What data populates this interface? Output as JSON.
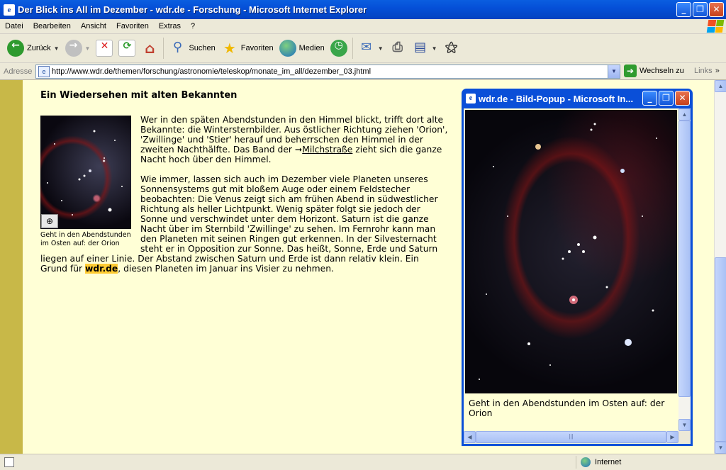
{
  "window": {
    "title": "Der Blick ins All im Dezember - wdr.de - Forschung - Microsoft Internet Explorer",
    "minimize": "_",
    "maximize": "❐",
    "close": "✕"
  },
  "menu": [
    "Datei",
    "Bearbeiten",
    "Ansicht",
    "Favoriten",
    "Extras",
    "?"
  ],
  "toolbar": {
    "back_label": "Zurück",
    "search_label": "Suchen",
    "favorites_label": "Favoriten",
    "media_label": "Medien"
  },
  "address": {
    "label": "Adresse",
    "url": "http://www.wdr.de/themen/forschung/astronomie/teleskop/monate_im_all/dezember_03.jhtml",
    "go_label": "Wechseln zu",
    "links_label": "Links"
  },
  "article": {
    "heading": "Ein Wiedersehen mit alten Bekannten",
    "thumb_caption": "Geht in den Abendstunden im Osten auf: der Orion",
    "p1_before": "Wer in den späten Abendstunden in den Himmel blickt, trifft dort alte Bekannte: die Wintersternbilder. Aus östlicher Richtung ziehen 'Orion', 'Zwillinge' und 'Stier' herauf und beherrschen den Himmel in der zweiten Nachthälfte. Das Band der ",
    "p1_link": "Milchstraße",
    "p1_after": " zieht sich die ganze Nacht hoch über den Himmel.",
    "p2_before": "Wie immer, lassen sich auch im Dezember viele Planeten unseres Sonnensystems gut mit bloßem Auge oder einem Feldstecher beobachten: Die Venus zeigt sich am frühen Abend in südwestlicher Richtung als heller Lichtpunkt. Wenig später folgt sie jedoch der Sonne und verschwindet unter dem Horizont. Saturn ist die ganze Nacht über im Sternbild 'Zwillinge' zu sehen. Im Fernrohr kann man den Planeten mit seinen Ringen gut erkennen. In der Silvesternacht steht er in Opposition zur Sonne. Das heißt, Sonne, Erde und Saturn liegen auf einer Linie. Der Abstand zwischen Saturn und Erde ist dann relativ klein. Ein Grund für ",
    "p2_highlight": "wdr.de",
    "p2_after": ", diesen Planeten im Januar ins Visier zu nehmen."
  },
  "popup": {
    "title": "wdr.de - Bild-Popup - Microsoft In...",
    "caption": "Geht in den Abendstunden im Osten auf: der Orion"
  },
  "status": {
    "zone": "Internet"
  },
  "colors": {
    "page_bg": "#ffffd6",
    "left_stripe": "#c8b848",
    "highlight": "#ffcc33",
    "xp_blue": "#0a4fd8"
  }
}
